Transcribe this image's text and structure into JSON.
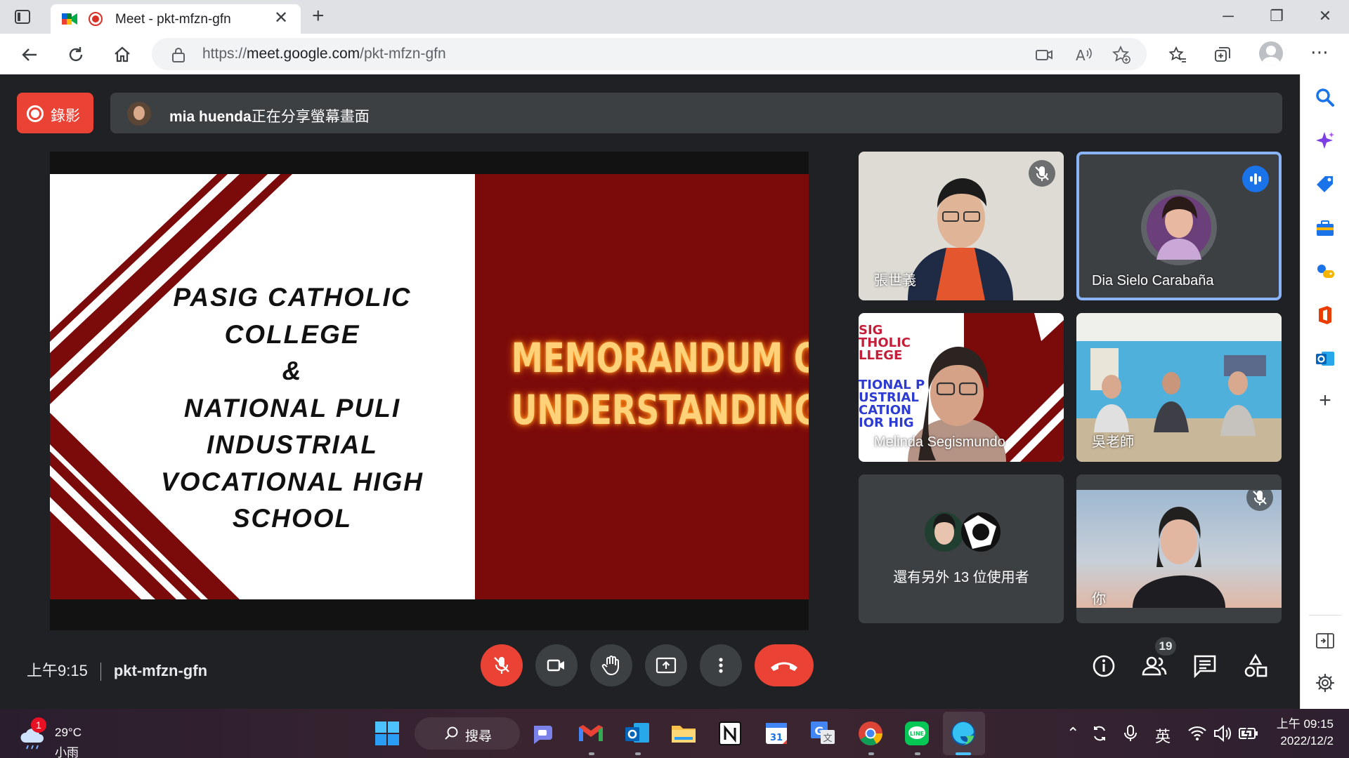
{
  "browser": {
    "tab_title": "Meet - pkt-mfzn-gfn",
    "url_host": "meet.google.com",
    "url_prefix": "https://",
    "url_path": "/pkt-mfzn-gfn"
  },
  "meet": {
    "record_label": "錄影",
    "presenter_name": "mia huenda",
    "presenting_suffix": "正在分享螢幕畫面",
    "slide": {
      "left_lines": [
        "PASIG CATHOLIC",
        "COLLEGE",
        "&",
        "NATIONAL PULI",
        "INDUSTRIAL",
        "VOCATIONAL HIGH",
        "SCHOOL"
      ],
      "right_lines": [
        "MEMORANDUM OF",
        "UNDERSTANDING"
      ]
    },
    "participants": [
      {
        "name": "張世義",
        "muted": true
      },
      {
        "name": "Dia Sielo Carabaña",
        "speaking": true
      },
      {
        "name": "Melinda Segismundo"
      },
      {
        "name": "吳老師"
      },
      {
        "name": "還有另外 13 位使用者"
      },
      {
        "name": "你",
        "muted": true
      }
    ],
    "time": "上午9:15",
    "meeting_code": "pkt-mfzn-gfn",
    "participant_count": "19",
    "colors": {
      "red": "#ea4335",
      "dark_bg": "#202124",
      "control_bg": "#3c4043",
      "slide_maroon": "#7b0a0a"
    }
  },
  "taskbar": {
    "weather_alert": "1",
    "temperature": "29°C",
    "condition": "小雨",
    "search_label": "搜尋",
    "input_lang": "英",
    "clock_time": "上午 09:15",
    "clock_date": "2022/12/2"
  }
}
